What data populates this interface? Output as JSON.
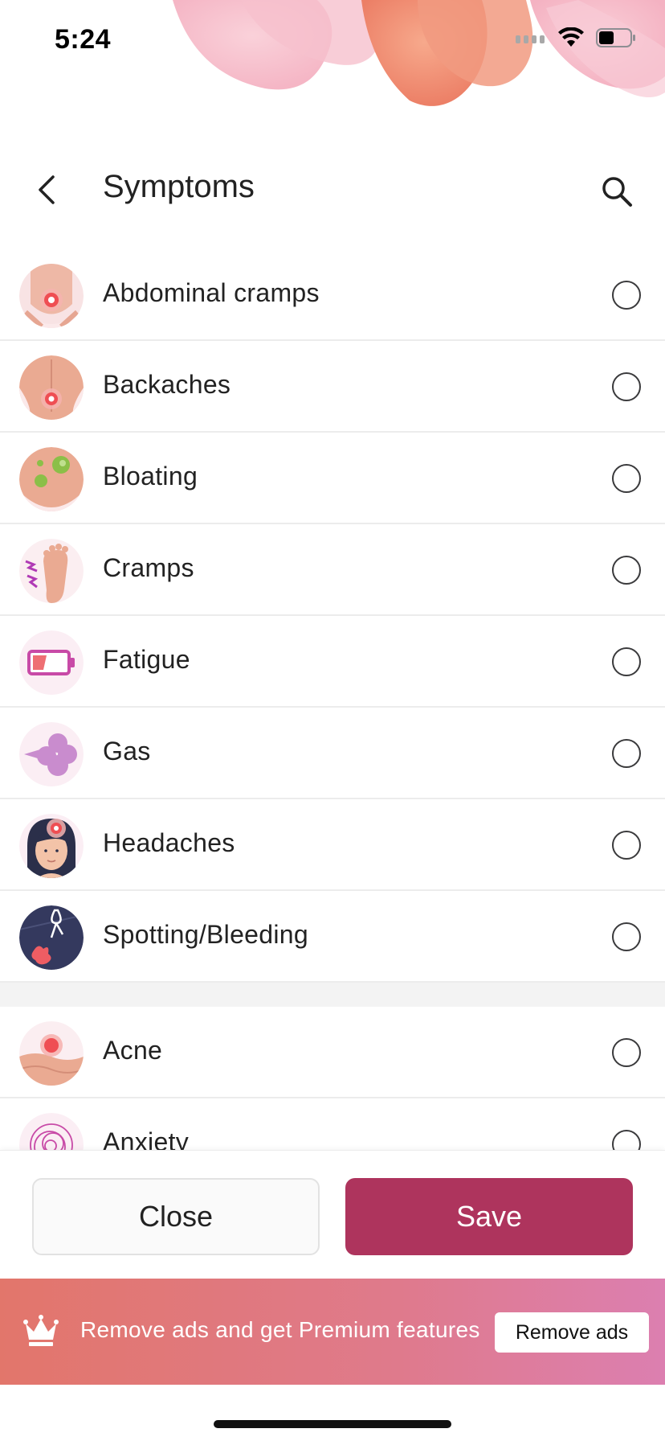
{
  "status_bar": {
    "time": "5:24"
  },
  "header": {
    "title": "Symptoms"
  },
  "symptoms": [
    {
      "label": "Abdominal cramps",
      "icon": "abdomen-pain-icon"
    },
    {
      "label": "Backaches",
      "icon": "back-pain-icon"
    },
    {
      "label": "Bloating",
      "icon": "bloating-icon"
    },
    {
      "label": "Cramps",
      "icon": "foot-cramp-icon"
    },
    {
      "label": "Fatigue",
      "icon": "low-battery-icon"
    },
    {
      "label": "Gas",
      "icon": "gas-cloud-icon"
    },
    {
      "label": "Headaches",
      "icon": "headache-icon"
    },
    {
      "label": "Spotting/Bleeding",
      "icon": "spotting-icon"
    },
    {
      "label": "Acne",
      "icon": "acne-icon"
    },
    {
      "label": "Anxiety",
      "icon": "anxiety-scribble-icon"
    }
  ],
  "footer": {
    "close_label": "Close",
    "save_label": "Save"
  },
  "ad": {
    "text": "Remove ads and get Premium features",
    "button_label": "Remove ads"
  },
  "colors": {
    "accent": "#ae345d",
    "ad_gradient_start": "#e2766b",
    "ad_gradient_end": "#dc7fb0"
  }
}
